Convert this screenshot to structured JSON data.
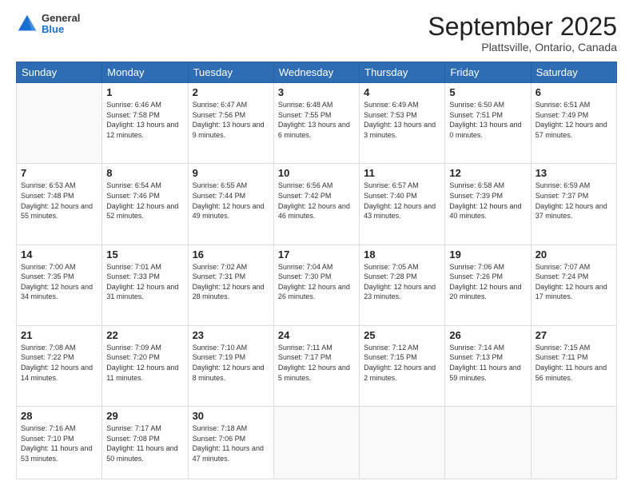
{
  "logo": {
    "general": "General",
    "blue": "Blue"
  },
  "header": {
    "month_title": "September 2025",
    "location": "Plattsville, Ontario, Canada"
  },
  "weekdays": [
    "Sunday",
    "Monday",
    "Tuesday",
    "Wednesday",
    "Thursday",
    "Friday",
    "Saturday"
  ],
  "weeks": [
    [
      {
        "day": "",
        "sunrise": "",
        "sunset": "",
        "daylight": ""
      },
      {
        "day": "1",
        "sunrise": "Sunrise: 6:46 AM",
        "sunset": "Sunset: 7:58 PM",
        "daylight": "Daylight: 13 hours and 12 minutes."
      },
      {
        "day": "2",
        "sunrise": "Sunrise: 6:47 AM",
        "sunset": "Sunset: 7:56 PM",
        "daylight": "Daylight: 13 hours and 9 minutes."
      },
      {
        "day": "3",
        "sunrise": "Sunrise: 6:48 AM",
        "sunset": "Sunset: 7:55 PM",
        "daylight": "Daylight: 13 hours and 6 minutes."
      },
      {
        "day": "4",
        "sunrise": "Sunrise: 6:49 AM",
        "sunset": "Sunset: 7:53 PM",
        "daylight": "Daylight: 13 hours and 3 minutes."
      },
      {
        "day": "5",
        "sunrise": "Sunrise: 6:50 AM",
        "sunset": "Sunset: 7:51 PM",
        "daylight": "Daylight: 13 hours and 0 minutes."
      },
      {
        "day": "6",
        "sunrise": "Sunrise: 6:51 AM",
        "sunset": "Sunset: 7:49 PM",
        "daylight": "Daylight: 12 hours and 57 minutes."
      }
    ],
    [
      {
        "day": "7",
        "sunrise": "Sunrise: 6:53 AM",
        "sunset": "Sunset: 7:48 PM",
        "daylight": "Daylight: 12 hours and 55 minutes."
      },
      {
        "day": "8",
        "sunrise": "Sunrise: 6:54 AM",
        "sunset": "Sunset: 7:46 PM",
        "daylight": "Daylight: 12 hours and 52 minutes."
      },
      {
        "day": "9",
        "sunrise": "Sunrise: 6:55 AM",
        "sunset": "Sunset: 7:44 PM",
        "daylight": "Daylight: 12 hours and 49 minutes."
      },
      {
        "day": "10",
        "sunrise": "Sunrise: 6:56 AM",
        "sunset": "Sunset: 7:42 PM",
        "daylight": "Daylight: 12 hours and 46 minutes."
      },
      {
        "day": "11",
        "sunrise": "Sunrise: 6:57 AM",
        "sunset": "Sunset: 7:40 PM",
        "daylight": "Daylight: 12 hours and 43 minutes."
      },
      {
        "day": "12",
        "sunrise": "Sunrise: 6:58 AM",
        "sunset": "Sunset: 7:39 PM",
        "daylight": "Daylight: 12 hours and 40 minutes."
      },
      {
        "day": "13",
        "sunrise": "Sunrise: 6:59 AM",
        "sunset": "Sunset: 7:37 PM",
        "daylight": "Daylight: 12 hours and 37 minutes."
      }
    ],
    [
      {
        "day": "14",
        "sunrise": "Sunrise: 7:00 AM",
        "sunset": "Sunset: 7:35 PM",
        "daylight": "Daylight: 12 hours and 34 minutes."
      },
      {
        "day": "15",
        "sunrise": "Sunrise: 7:01 AM",
        "sunset": "Sunset: 7:33 PM",
        "daylight": "Daylight: 12 hours and 31 minutes."
      },
      {
        "day": "16",
        "sunrise": "Sunrise: 7:02 AM",
        "sunset": "Sunset: 7:31 PM",
        "daylight": "Daylight: 12 hours and 28 minutes."
      },
      {
        "day": "17",
        "sunrise": "Sunrise: 7:04 AM",
        "sunset": "Sunset: 7:30 PM",
        "daylight": "Daylight: 12 hours and 26 minutes."
      },
      {
        "day": "18",
        "sunrise": "Sunrise: 7:05 AM",
        "sunset": "Sunset: 7:28 PM",
        "daylight": "Daylight: 12 hours and 23 minutes."
      },
      {
        "day": "19",
        "sunrise": "Sunrise: 7:06 AM",
        "sunset": "Sunset: 7:26 PM",
        "daylight": "Daylight: 12 hours and 20 minutes."
      },
      {
        "day": "20",
        "sunrise": "Sunrise: 7:07 AM",
        "sunset": "Sunset: 7:24 PM",
        "daylight": "Daylight: 12 hours and 17 minutes."
      }
    ],
    [
      {
        "day": "21",
        "sunrise": "Sunrise: 7:08 AM",
        "sunset": "Sunset: 7:22 PM",
        "daylight": "Daylight: 12 hours and 14 minutes."
      },
      {
        "day": "22",
        "sunrise": "Sunrise: 7:09 AM",
        "sunset": "Sunset: 7:20 PM",
        "daylight": "Daylight: 12 hours and 11 minutes."
      },
      {
        "day": "23",
        "sunrise": "Sunrise: 7:10 AM",
        "sunset": "Sunset: 7:19 PM",
        "daylight": "Daylight: 12 hours and 8 minutes."
      },
      {
        "day": "24",
        "sunrise": "Sunrise: 7:11 AM",
        "sunset": "Sunset: 7:17 PM",
        "daylight": "Daylight: 12 hours and 5 minutes."
      },
      {
        "day": "25",
        "sunrise": "Sunrise: 7:12 AM",
        "sunset": "Sunset: 7:15 PM",
        "daylight": "Daylight: 12 hours and 2 minutes."
      },
      {
        "day": "26",
        "sunrise": "Sunrise: 7:14 AM",
        "sunset": "Sunset: 7:13 PM",
        "daylight": "Daylight: 11 hours and 59 minutes."
      },
      {
        "day": "27",
        "sunrise": "Sunrise: 7:15 AM",
        "sunset": "Sunset: 7:11 PM",
        "daylight": "Daylight: 11 hours and 56 minutes."
      }
    ],
    [
      {
        "day": "28",
        "sunrise": "Sunrise: 7:16 AM",
        "sunset": "Sunset: 7:10 PM",
        "daylight": "Daylight: 11 hours and 53 minutes."
      },
      {
        "day": "29",
        "sunrise": "Sunrise: 7:17 AM",
        "sunset": "Sunset: 7:08 PM",
        "daylight": "Daylight: 11 hours and 50 minutes."
      },
      {
        "day": "30",
        "sunrise": "Sunrise: 7:18 AM",
        "sunset": "Sunset: 7:06 PM",
        "daylight": "Daylight: 11 hours and 47 minutes."
      },
      {
        "day": "",
        "sunrise": "",
        "sunset": "",
        "daylight": ""
      },
      {
        "day": "",
        "sunrise": "",
        "sunset": "",
        "daylight": ""
      },
      {
        "day": "",
        "sunrise": "",
        "sunset": "",
        "daylight": ""
      },
      {
        "day": "",
        "sunrise": "",
        "sunset": "",
        "daylight": ""
      }
    ]
  ]
}
